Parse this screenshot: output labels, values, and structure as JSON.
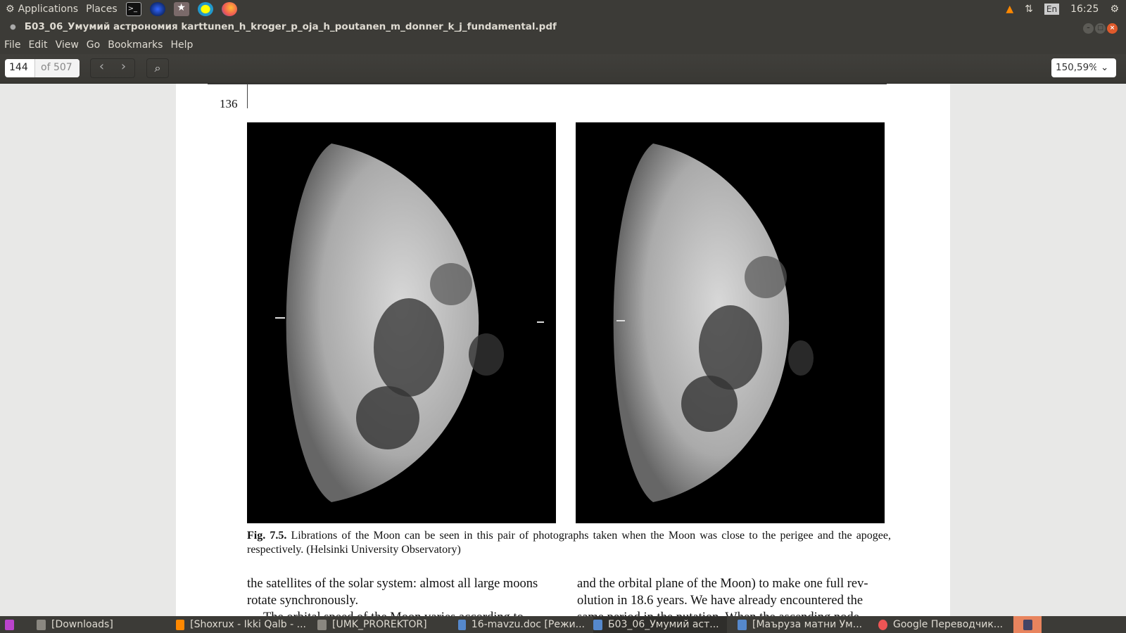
{
  "topbar": {
    "applications": "Applications",
    "places": "Places",
    "keyboard": "En",
    "clock": "16:25"
  },
  "window": {
    "title": "Б03_06_Умумий астрономия karttunen_h_kroger_p_oja_h_poutanen_m_donner_k_j_fundamental.pdf"
  },
  "menu": [
    "File",
    "Edit",
    "View",
    "Go",
    "Bookmarks",
    "Help"
  ],
  "toolbar": {
    "page_current": "144",
    "page_total": "of 507",
    "zoom": "150,59%"
  },
  "document": {
    "page_number": "136",
    "caption_label": "Fig. 7.5.",
    "caption_text": " Librations of the Moon can be seen in this pair of photographs taken when the Moon was close to the perigee and the apogee, respectively. (Helsinki University Observatory)",
    "left_col": [
      "the satellites of the solar system: almost all large moons",
      "rotate synchronously.",
      "The orbital speed of the Moon varies according to"
    ],
    "right_col": [
      "and the orbital plane of the Moon) to make one full rev-",
      "olution in 18.6 years. We have already encountered the",
      "same period in the nutation. When the ascending node"
    ]
  },
  "taskbar": [
    "[Downloads]",
    "[Shoxrux - Ikki Qalb - ...",
    "[UMK_PROREKTOR]",
    "16-mavzu.doc [Режи...",
    "Б03_06_Умумий аст...",
    "[Маъруза матни Ум...",
    "Google Переводчик..."
  ],
  "colors": {
    "panel": "#3c3b37",
    "close": "#e05a2b"
  }
}
